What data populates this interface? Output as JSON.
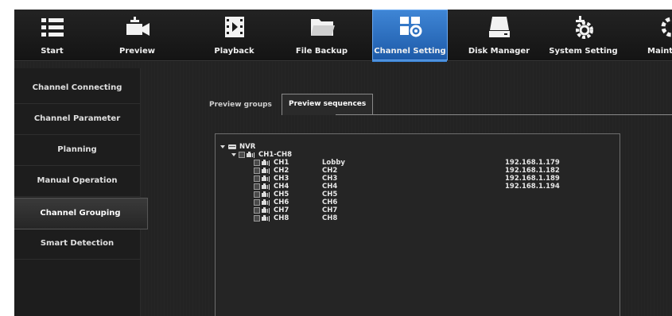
{
  "toolbar": {
    "items": [
      {
        "label": "Start",
        "icon": "list-icon"
      },
      {
        "label": "Preview",
        "icon": "camera-icon"
      },
      {
        "label": "Playback",
        "icon": "film-icon"
      },
      {
        "label": "File Backup",
        "icon": "folder-icon"
      },
      {
        "label": "Channel Setting",
        "icon": "channel-setting-icon",
        "active": true
      },
      {
        "label": "Disk Manager",
        "icon": "hard-disk-icon"
      },
      {
        "label": "System Setting",
        "icon": "system-gear-icon"
      },
      {
        "label": "Mainte",
        "icon": "maintenance-gear-icon"
      }
    ],
    "active_color": "#3f86d6"
  },
  "sidebar": {
    "items": [
      {
        "label": "Channel Connecting"
      },
      {
        "label": "Channel Parameter"
      },
      {
        "label": "Planning"
      },
      {
        "label": "Manual Operation"
      },
      {
        "label": "Channel Grouping",
        "active": true
      },
      {
        "label": "Smart Detection"
      }
    ]
  },
  "tabs": [
    {
      "label": "Preview groups"
    },
    {
      "label": "Preview sequences",
      "active": true
    }
  ],
  "tree": {
    "root": "NVR",
    "group": "CH1-CH8",
    "channels": [
      {
        "id": "CH1",
        "name": "Lobby",
        "ip": "192.168.1.179"
      },
      {
        "id": "CH2",
        "name": "CH2",
        "ip": "192.168.1.182"
      },
      {
        "id": "CH3",
        "name": "CH3",
        "ip": "192.168.1.189"
      },
      {
        "id": "CH4",
        "name": "CH4",
        "ip": "192.168.1.194"
      },
      {
        "id": "CH5",
        "name": "CH5",
        "ip": ""
      },
      {
        "id": "CH6",
        "name": "CH6",
        "ip": ""
      },
      {
        "id": "CH7",
        "name": "CH7",
        "ip": ""
      },
      {
        "id": "CH8",
        "name": "CH8",
        "ip": ""
      }
    ]
  },
  "add_button": {
    "label": "+"
  }
}
